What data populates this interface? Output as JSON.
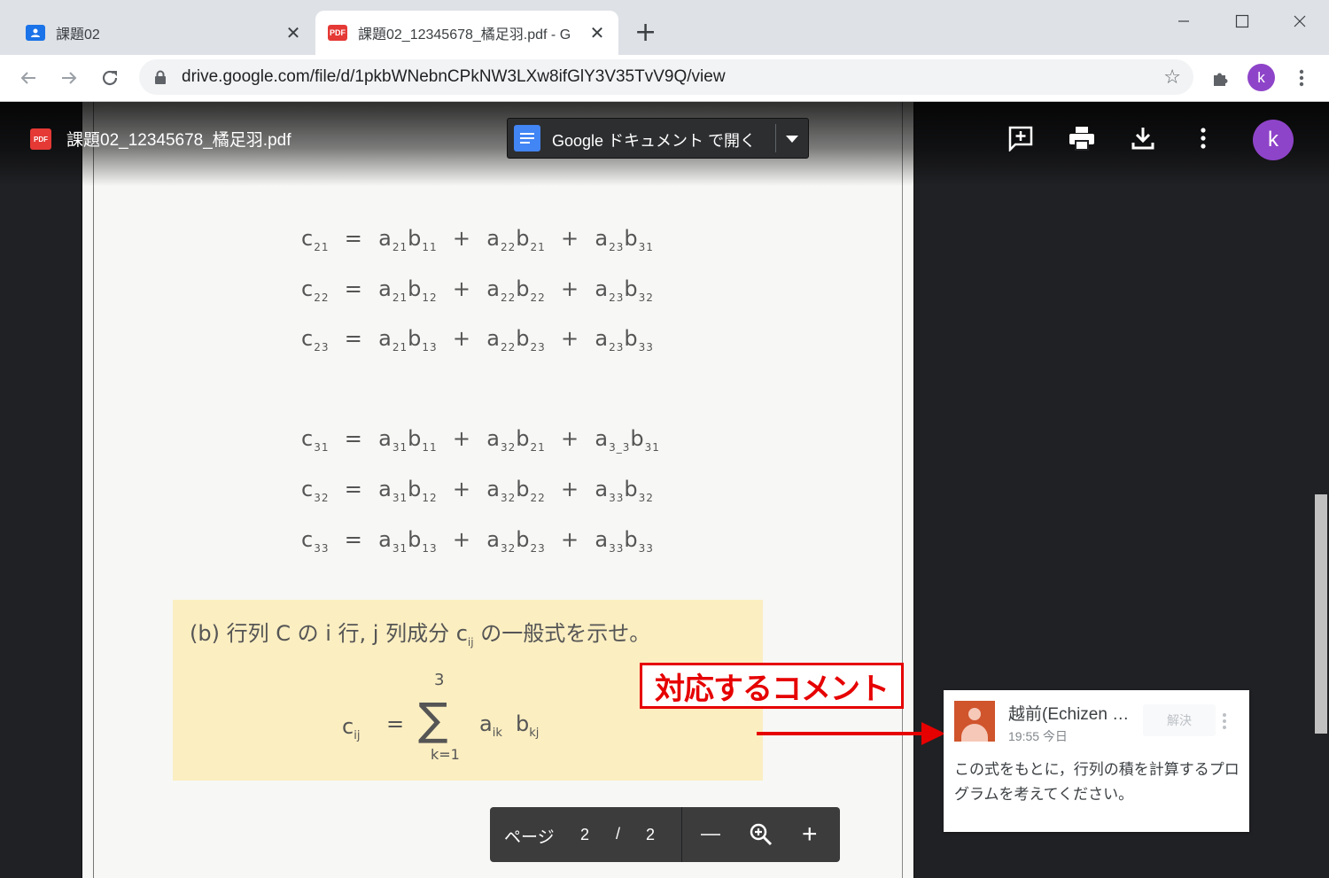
{
  "browser": {
    "tabs": [
      {
        "title": "課題02",
        "icon": "google-classroom-icon",
        "close": "✕"
      },
      {
        "title": "課題02_12345678_橘足羽.pdf - G",
        "icon": "pdf-icon",
        "close": "✕",
        "active": true
      }
    ],
    "new_tab": "+",
    "url": "drive.google.com/file/d/1pkbWNebnCPkNW3LXw8ifGlY3V35TvV9Q/view",
    "profile_initial": "k"
  },
  "viewer": {
    "pdf_badge": "PDF",
    "file_name": "課題02_12345678_橘足羽.pdf",
    "open_with_label": "Google ドキュメント で開く",
    "profile_initial": "k",
    "page_label": "ページ",
    "current_page": "2",
    "page_separator": "/",
    "total_pages": "2"
  },
  "document": {
    "equations": [
      {
        "c": "c",
        "ci": "21",
        "rhs": [
          [
            "21",
            "11"
          ],
          [
            "22",
            "21"
          ],
          [
            "23",
            "31"
          ]
        ]
      },
      {
        "c": "c",
        "ci": "22",
        "rhs": [
          [
            "21",
            "12"
          ],
          [
            "22",
            "22"
          ],
          [
            "23",
            "32"
          ]
        ]
      },
      {
        "c": "c",
        "ci": "23",
        "rhs": [
          [
            "21",
            "13"
          ],
          [
            "22",
            "23"
          ],
          [
            "23",
            "33"
          ]
        ]
      },
      {
        "c": "c",
        "ci": "31",
        "rhs": [
          [
            "31",
            "11"
          ],
          [
            "32",
            "21"
          ],
          [
            "3_3",
            "31"
          ]
        ]
      },
      {
        "c": "c",
        "ci": "32",
        "rhs": [
          [
            "31",
            "12"
          ],
          [
            "32",
            "22"
          ],
          [
            "33",
            "32"
          ]
        ]
      },
      {
        "c": "c",
        "ci": "33",
        "rhs": [
          [
            "31",
            "13"
          ],
          [
            "32",
            "23"
          ],
          [
            "33",
            "33"
          ]
        ]
      }
    ],
    "question": "(b) 行列 C の i 行, j 列成分 c",
    "question_sub": "ij",
    "question_tail": " の一般式を示せ。",
    "formula": {
      "lhs": "c",
      "lhs_sub": "ij",
      "eq": "=",
      "sigma": "∑",
      "upper": "3",
      "lower": "k=1",
      "a": "a",
      "a_sub": "ik",
      "b": "b",
      "b_sub": "kj"
    }
  },
  "annotation": {
    "label": "対応するコメント",
    "color": "#e60000"
  },
  "comment": {
    "author": "越前(Echizen …",
    "time": "19:55 今日",
    "resolve_label": "解決",
    "text": "この式をもとに，行列の積を計算するプログラムを考えてください。"
  }
}
